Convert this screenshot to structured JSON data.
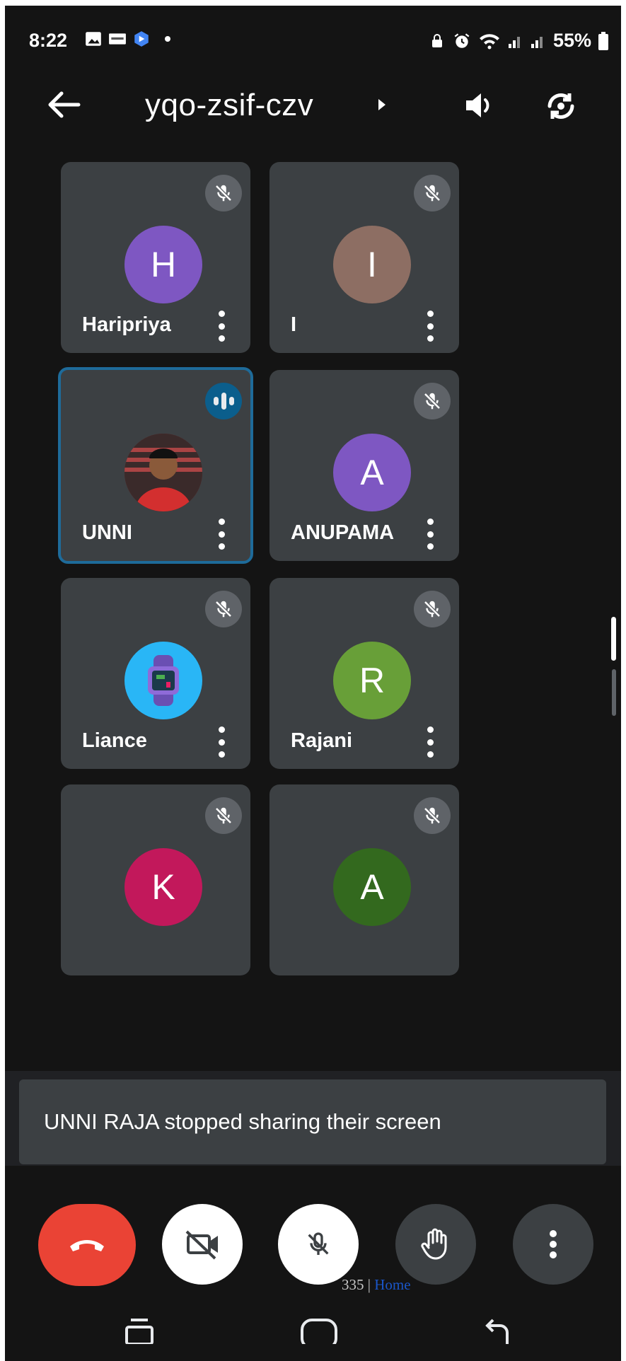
{
  "status_bar": {
    "time": "8:22",
    "battery": "55%"
  },
  "header": {
    "meeting_code": "yqo-zsif-czv"
  },
  "participants": [
    {
      "name": "Haripriya",
      "initial": "H",
      "avatar_color": "#7e57c2",
      "muted": true
    },
    {
      "name": "I",
      "initial": "I",
      "avatar_color": "#8d6e63",
      "muted": true
    },
    {
      "name": "UNNI",
      "initial": "",
      "avatar_color": "#b71c1c",
      "muted": false,
      "speaking": true,
      "photo": true
    },
    {
      "name": "ANUPAMA",
      "initial": "A",
      "avatar_color": "#7e57c2",
      "muted": true
    },
    {
      "name": "Liance",
      "initial": "",
      "avatar_color": "#29b6f6",
      "muted": true,
      "photo": true
    },
    {
      "name": "Rajani",
      "initial": "R",
      "avatar_color": "#689f38",
      "muted": true
    },
    {
      "name": "",
      "initial": "K",
      "avatar_color": "#c2185b",
      "muted": true
    },
    {
      "name": "",
      "initial": "A",
      "avatar_color": "#33691e",
      "muted": true
    }
  ],
  "toast": {
    "message": "UNNI RAJA stopped sharing their screen"
  },
  "controls": {
    "hangup": "phone-hangup-icon",
    "camera": "camera-off-icon",
    "mic": "mic-off-icon",
    "hand": "raise-hand-icon",
    "more": "more-vert-icon"
  },
  "overlay": {
    "page_number": "335",
    "separator": "|",
    "link": "Home"
  },
  "colors": {
    "background": "#141414",
    "tile": "#3c4043",
    "hangup": "#ea4335",
    "speaking_border": "#1e6b9a"
  }
}
